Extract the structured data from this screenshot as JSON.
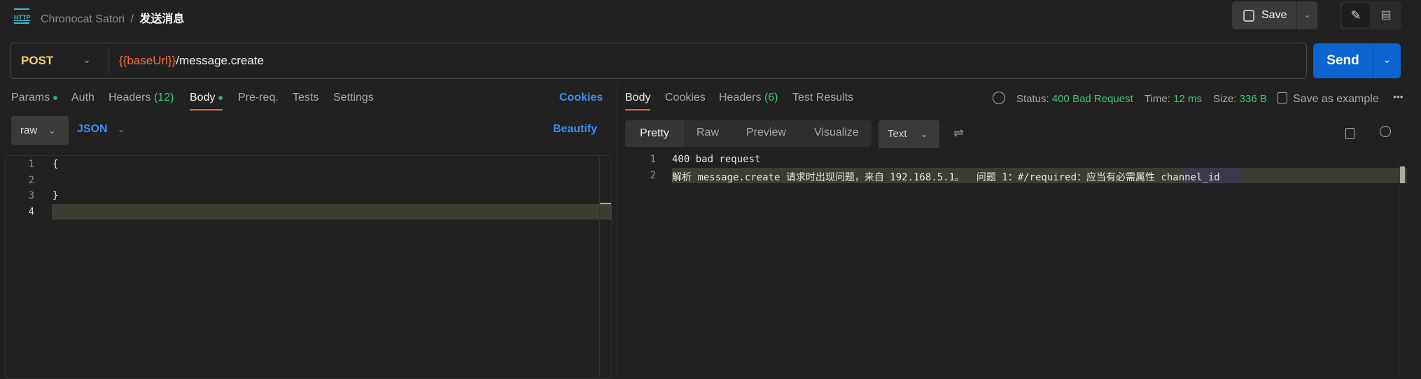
{
  "header": {
    "icon": "http-icon",
    "collection": "Chronocat Satori",
    "separator": "/",
    "request_name": "发送消息",
    "save_label": "Save"
  },
  "url_bar": {
    "method": "POST",
    "url_variable": "{{baseUrl}}",
    "url_path": "/message.create",
    "send_label": "Send"
  },
  "request_tabs": [
    {
      "label": "Params",
      "dot": true
    },
    {
      "label": "Auth"
    },
    {
      "label": "Headers",
      "count": "(12)"
    },
    {
      "label": "Body",
      "dot": true,
      "active": true
    },
    {
      "label": "Pre-req."
    },
    {
      "label": "Tests"
    },
    {
      "label": "Settings"
    }
  ],
  "cookies_label": "Cookies",
  "body_options": {
    "mode": "raw",
    "format": "JSON",
    "beautify": "Beautify"
  },
  "request_body": {
    "lines": [
      "1",
      "2",
      "3",
      "4"
    ],
    "code": [
      "{",
      "",
      "}",
      ""
    ]
  },
  "response_tabs": [
    {
      "label": "Body",
      "active": true
    },
    {
      "label": "Cookies"
    },
    {
      "label": "Headers",
      "count": "(6)"
    },
    {
      "label": "Test Results"
    }
  ],
  "response_meta": {
    "status_label": "Status:",
    "status": "400 Bad Request",
    "time_label": "Time:",
    "time": "12 ms",
    "size_label": "Size:",
    "size": "336 B",
    "save_example": "Save as example"
  },
  "view_modes": [
    "Pretty",
    "Raw",
    "Preview",
    "Visualize"
  ],
  "response_format": "Text",
  "response_body": {
    "line1": "400 bad request",
    "line2_prefix": "解析 message.create 请求时出现问题，来自 192.168.5.1。  问题 1：#/required：应当有必需属性 ",
    "line2_highlight": "channel_id"
  },
  "colors": {
    "accent": "#f26b3a",
    "send": "#0b64d0",
    "status_ok": "#3cc77a",
    "link": "#3b8ff0",
    "variable": "#f0713a",
    "method": "#f5d16c"
  }
}
